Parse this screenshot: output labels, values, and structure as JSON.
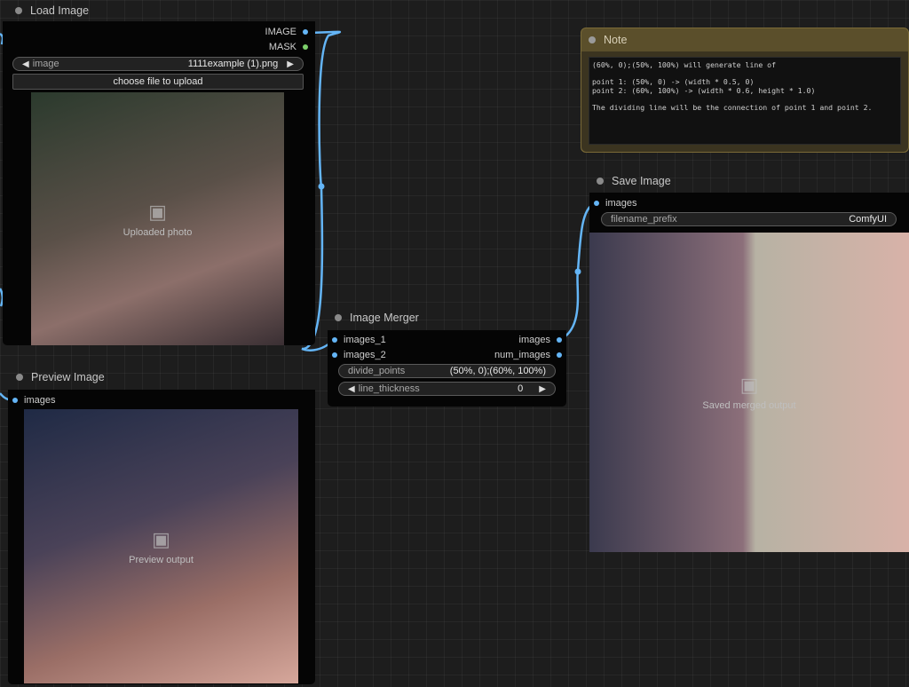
{
  "colors": {
    "canvas_bg": "#1d1d1d",
    "wire_blue": "#64b5f6",
    "mask_green": "#7ccf6b",
    "note_title_bg": "#5b4f2b",
    "note_border": "#7a6a37"
  },
  "load_image": {
    "title": "Load Image",
    "outputs": [
      "IMAGE",
      "MASK"
    ],
    "image_widget": {
      "label": "image",
      "value": "1111example (1).png"
    },
    "upload_label": "choose file to upload",
    "photo_alt": "Uploaded photo"
  },
  "preview_image": {
    "title": "Preview Image",
    "input": "images",
    "photo_alt": "Preview output"
  },
  "image_merger": {
    "title": "Image Merger",
    "inputs": [
      "images_1",
      "images_2"
    ],
    "outputs": [
      "images",
      "num_images"
    ],
    "divide_points": {
      "label": "divide_points",
      "value": "(50%, 0);(60%, 100%)"
    },
    "line_thickness": {
      "label": "line_thickness",
      "value": "0"
    }
  },
  "note": {
    "title": "Note",
    "text": "(60%, 0);(50%, 100%) will generate line of\n\npoint 1: (50%, 0) -> (width * 0.5, 0)\npoint 2: (60%, 100%) -> (width * 0.6, height * 1.0)\n\nThe dividing line will be the connection of point 1 and point 2."
  },
  "save_image": {
    "title": "Save Image",
    "input": "images",
    "filename_prefix": {
      "label": "filename_prefix",
      "value": "ComfyUI"
    },
    "photo_alt": "Saved merged output"
  }
}
